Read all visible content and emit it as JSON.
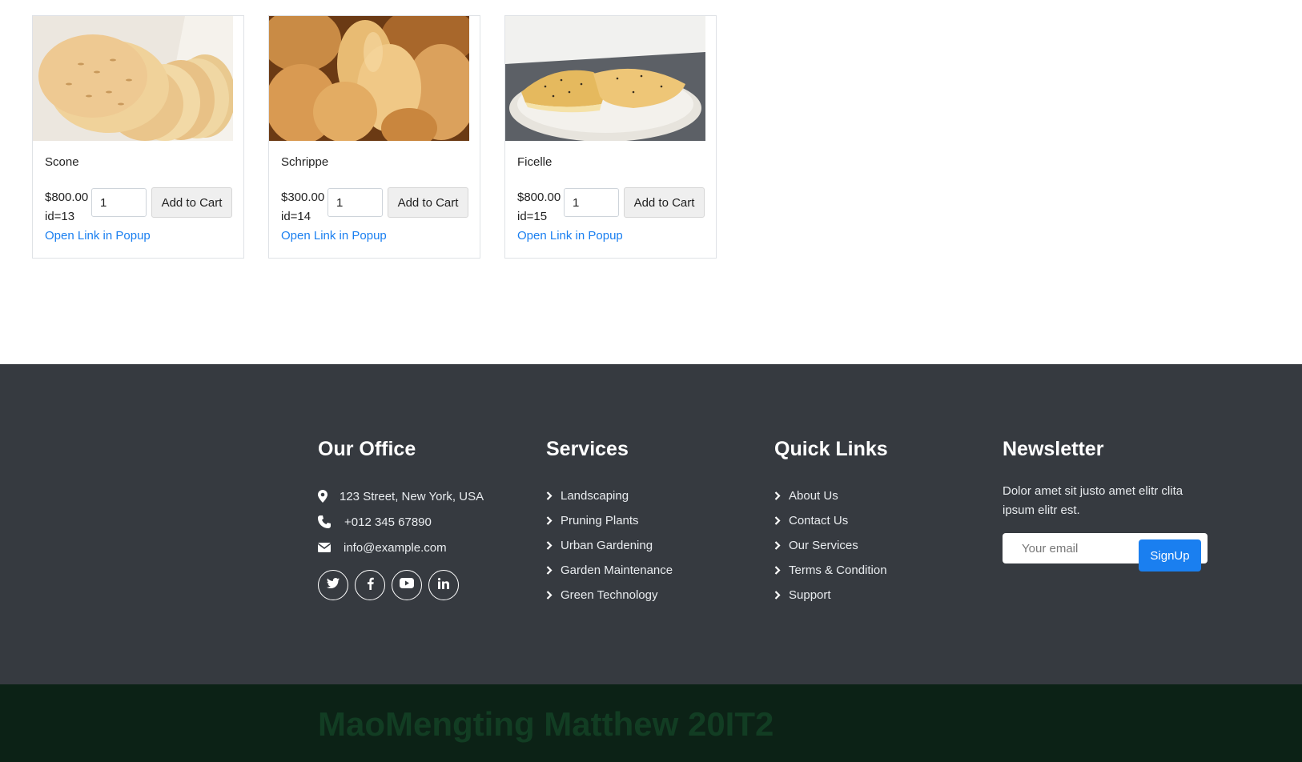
{
  "products": [
    {
      "name": "Scone",
      "price": "$800.00",
      "id_label": "id=13",
      "quantity": "1",
      "cart_label": "Add to Cart",
      "popup_label": "Open Link in Popup",
      "image_icon": "flatbread-image"
    },
    {
      "name": "Schrippe",
      "price": "$300.00",
      "id_label": "id=14",
      "quantity": "1",
      "cart_label": "Add to Cart",
      "popup_label": "Open Link in Popup",
      "image_icon": "bread-rolls-image"
    },
    {
      "name": "Ficelle",
      "price": "$800.00",
      "id_label": "id=15",
      "quantity": "1",
      "cart_label": "Add to Cart",
      "popup_label": "Open Link in Popup",
      "image_icon": "focaccia-image"
    }
  ],
  "footer": {
    "office": {
      "title": "Our Office",
      "address": "123 Street, New York, USA",
      "phone": "+012 345 67890",
      "email": "info@example.com",
      "social_icons": [
        "twitter-icon",
        "facebook-icon",
        "youtube-icon",
        "linkedin-icon"
      ]
    },
    "services": {
      "title": "Services",
      "items": [
        "Landscaping",
        "Pruning Plants",
        "Urban Gardening",
        "Garden Maintenance",
        "Green Technology"
      ]
    },
    "quick_links": {
      "title": "Quick Links",
      "items": [
        "About Us",
        "Contact Us",
        "Our Services",
        "Terms & Condition",
        "Support"
      ]
    },
    "newsletter": {
      "title": "Newsletter",
      "text": "Dolor amet sit justo amet elitr clita ipsum elitr est.",
      "placeholder": "Your email",
      "button_label": "SignUp"
    }
  },
  "bottom_bar": {
    "credit": "MaoMengting Matthew 20IT2"
  },
  "colors": {
    "link": "#1a7ff0",
    "footer_bg": "#363a40",
    "bottom_bg": "#0c2216",
    "credit_text": "#123d23",
    "signup_bg": "#1a7ff0"
  }
}
